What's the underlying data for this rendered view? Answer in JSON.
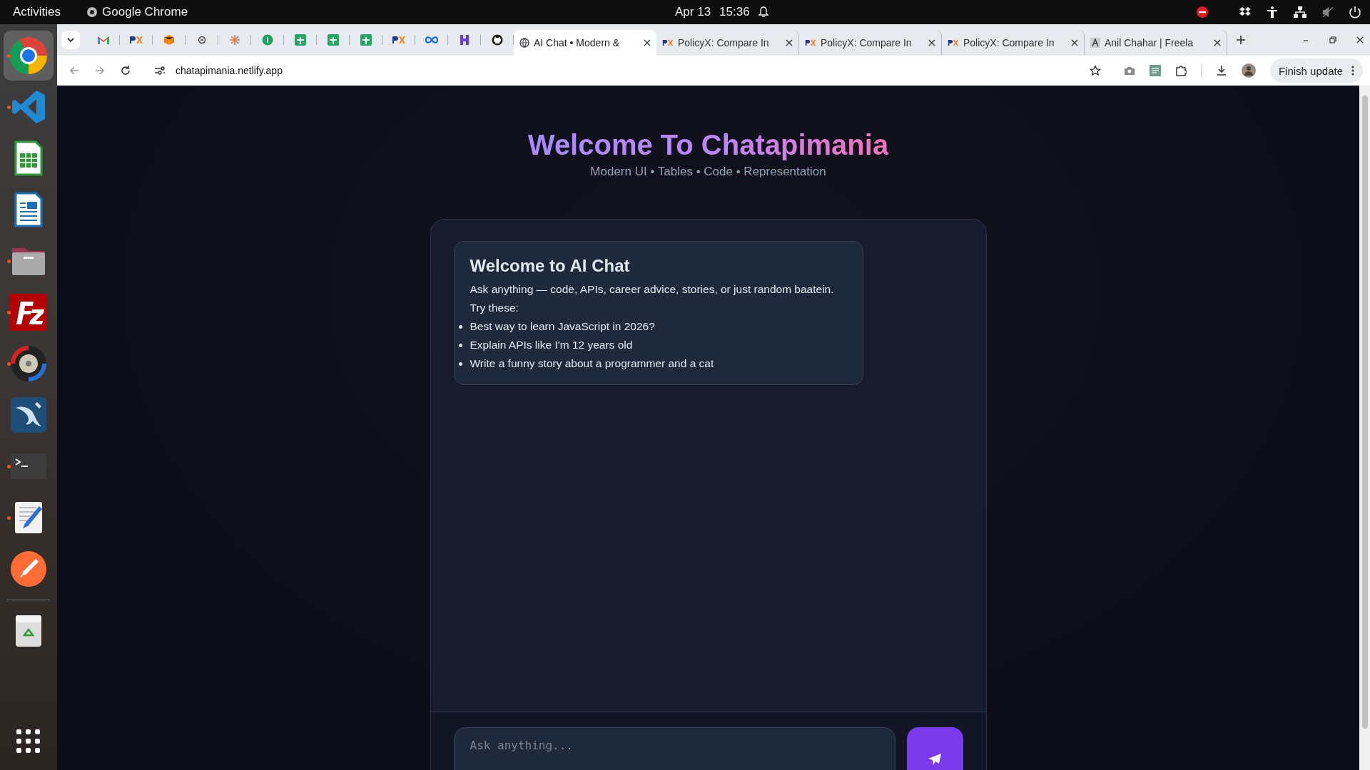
{
  "top_bar": {
    "activities": "Activities",
    "app_name": "Google Chrome",
    "date": "Apr 13",
    "time": "15:36"
  },
  "dock": [
    {
      "kind": "browser",
      "running": true,
      "selected": true
    },
    {
      "kind": "code",
      "running": true,
      "selected": false
    },
    {
      "kind": "sheet",
      "running": false,
      "selected": false
    },
    {
      "kind": "doc",
      "running": false,
      "selected": false
    },
    {
      "kind": "files",
      "running": true,
      "selected": false
    },
    {
      "kind": "ftp",
      "running": true,
      "selected": false
    },
    {
      "kind": "disc",
      "running": true,
      "selected": false
    },
    {
      "kind": "dolphin",
      "running": false,
      "selected": false
    },
    {
      "kind": "terminal",
      "running": true,
      "selected": false
    },
    {
      "kind": "editor",
      "running": true,
      "selected": false
    },
    {
      "kind": "rocket",
      "running": false,
      "selected": false
    },
    {
      "kind": "trash",
      "running": false,
      "selected": false
    }
  ],
  "tabs": [
    {
      "title": "AI Chat • Modern &",
      "kind": "globe",
      "selected": true
    },
    {
      "title": "PolicyX: Compare In",
      "kind": "px",
      "selected": false
    },
    {
      "title": "PolicyX: Compare In",
      "kind": "px",
      "selected": false
    },
    {
      "title": "PolicyX: Compare In",
      "kind": "px",
      "selected": false
    },
    {
      "title": "Anil Chahar | Freela",
      "kind": "logo",
      "selected": false
    }
  ],
  "address_bar": {
    "url": "chatapimania.netlify.app"
  },
  "update_button": "Finish update",
  "page": {
    "title": "Welcome To Chatapimania",
    "subtitle": "Modern UI • Tables • Code • Representation",
    "welcome_card": {
      "heading": "Welcome to AI Chat",
      "intro": "Ask anything — code, APIs, career advice, stories, or just random baatein.",
      "try_label": "Try these:",
      "suggestions": [
        "Best way to learn JavaScript in 2026?",
        "Explain APIs like I'm 12 years old",
        "Write a funny story about a programmer and a cat"
      ]
    },
    "input": {
      "placeholder": "Ask anything..."
    }
  }
}
